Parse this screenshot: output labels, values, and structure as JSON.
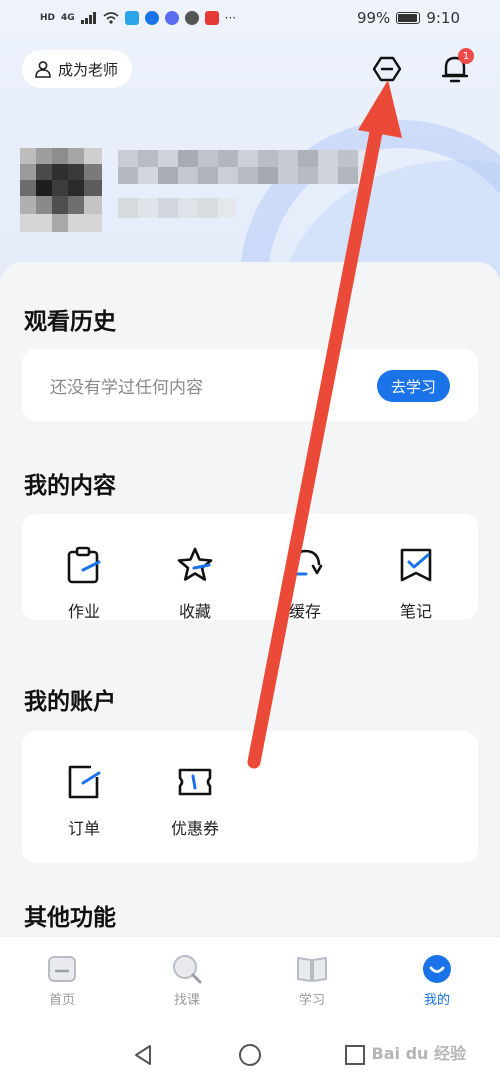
{
  "status_bar": {
    "left_labels": [
      "HD",
      "4G"
    ],
    "battery": "99%",
    "time": "9:10"
  },
  "header": {
    "teacher_label": "成为老师",
    "notification_count": "1"
  },
  "watch_history": {
    "title": "观看历史",
    "empty_text": "还没有学过任何内容",
    "study_button": "去学习"
  },
  "my_content": {
    "title": "我的内容",
    "items": [
      {
        "label": "作业",
        "icon": "homework-icon"
      },
      {
        "label": "收藏",
        "icon": "favorite-star-icon"
      },
      {
        "label": "缓存",
        "icon": "cache-download-icon"
      },
      {
        "label": "笔记",
        "icon": "notes-icon"
      }
    ]
  },
  "my_account": {
    "title": "我的账户",
    "items": [
      {
        "label": "订单",
        "icon": "order-icon"
      },
      {
        "label": "优惠券",
        "icon": "coupon-icon"
      }
    ]
  },
  "other_functions": {
    "title": "其他功能"
  },
  "tabbar": {
    "tabs": [
      {
        "label": "首页",
        "icon": "home-icon"
      },
      {
        "label": "找课",
        "icon": "search-course-icon"
      },
      {
        "label": "学习",
        "icon": "book-icon"
      },
      {
        "label": "我的",
        "icon": "profile-icon",
        "active": true
      }
    ]
  },
  "watermark": "Bai du 经验",
  "colors": {
    "accent": "#1a73e8",
    "arrow": "#ec4a38",
    "badge": "#f04a4a"
  }
}
